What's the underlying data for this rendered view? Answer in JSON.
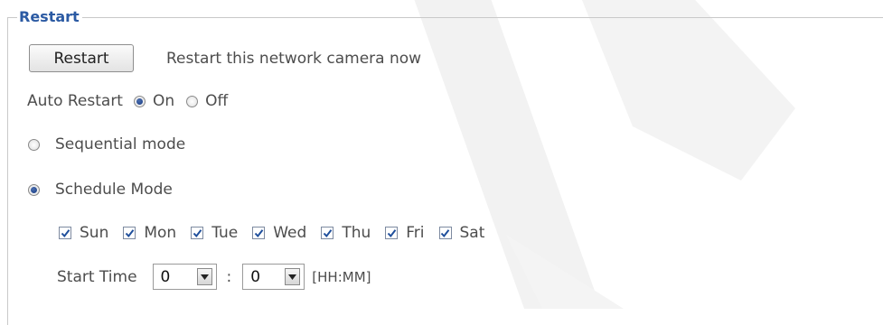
{
  "section": {
    "legend": "Restart"
  },
  "restart": {
    "button_label": "Restart",
    "description": "Restart this network camera now"
  },
  "auto_restart": {
    "label": "Auto Restart",
    "on_label": "On",
    "off_label": "Off",
    "selected": "On"
  },
  "modes": {
    "sequential_label": "Sequential mode",
    "schedule_label": "Schedule Mode",
    "selected": "Schedule Mode"
  },
  "days": [
    {
      "label": "Sun",
      "checked": true
    },
    {
      "label": "Mon",
      "checked": true
    },
    {
      "label": "Tue",
      "checked": true
    },
    {
      "label": "Wed",
      "checked": true
    },
    {
      "label": "Thu",
      "checked": true
    },
    {
      "label": "Fri",
      "checked": true
    },
    {
      "label": "Sat",
      "checked": true
    }
  ],
  "start_time": {
    "label": "Start Time",
    "hour": "0",
    "separator": ":",
    "minute": "0",
    "format": "[HH:MM]"
  },
  "colors": {
    "legend": "#2b5aa3",
    "text": "#4d4d4d",
    "radio_dot": "#1f4590",
    "check": "#1f4f9c"
  }
}
